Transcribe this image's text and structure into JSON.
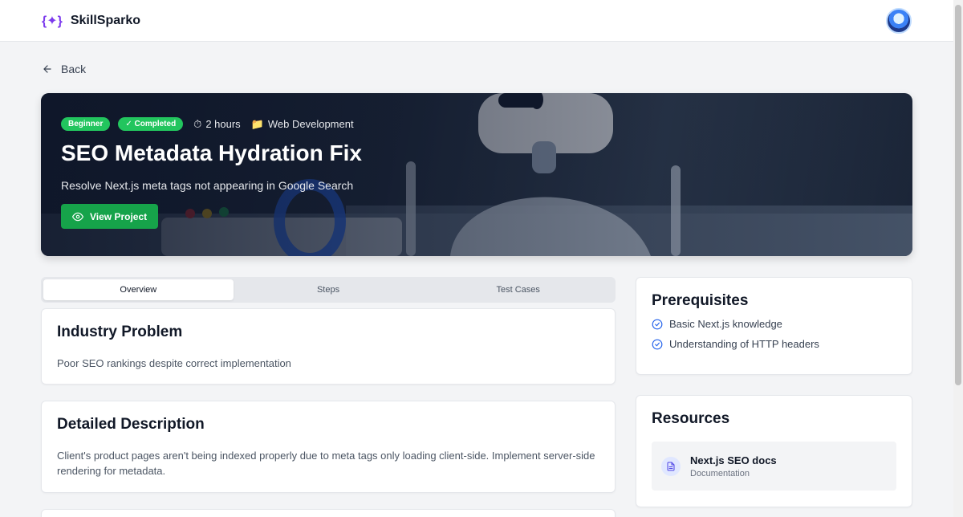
{
  "nav": {
    "logo_glyph": "{✦}",
    "brand": "SkillSparko"
  },
  "back_label": "Back",
  "hero": {
    "badges": [
      "Beginner",
      "✓ Completed"
    ],
    "duration": "2 hours",
    "category": "Web Development",
    "title": "SEO Metadata Hydration Fix",
    "subtitle": "Resolve Next.js meta tags not appearing in Google Search",
    "button_label": "View Project"
  },
  "tabs": [
    {
      "label": "Overview",
      "active": true
    },
    {
      "label": "Steps",
      "active": false
    },
    {
      "label": "Test Cases",
      "active": false
    }
  ],
  "industry_problem": {
    "heading": "Industry Problem",
    "text": "Poor SEO rankings despite correct implementation"
  },
  "detailed_description": {
    "heading": "Detailed Description",
    "text": "Client's product pages aren't being indexed properly due to meta tags only loading client-side. Implement server-side rendering for metadata."
  },
  "prerequisites": {
    "heading": "Prerequisites",
    "items": [
      "Basic Next.js knowledge",
      "Understanding of HTTP headers"
    ]
  },
  "resources": {
    "heading": "Resources",
    "items": [
      {
        "title": "Next.js SEO docs",
        "type": "Documentation"
      }
    ]
  },
  "colors": {
    "accent_green": "#16a34a",
    "badge_green": "#22c55e",
    "brand_purple": "#7c3aed",
    "check_blue": "#2563eb"
  }
}
